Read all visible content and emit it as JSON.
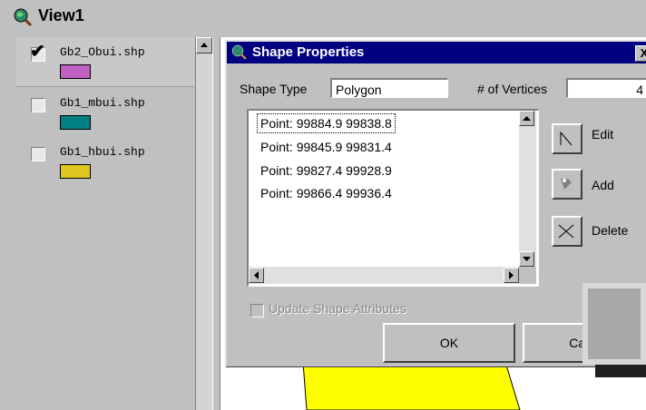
{
  "window": {
    "title": "View1",
    "icon": "globe-magnifier-icon"
  },
  "legend": {
    "items": [
      {
        "name": "Gb2_Obui.shp",
        "checked": true,
        "color": "#c060c0"
      },
      {
        "name": "Gb1_mbui.shp",
        "checked": false,
        "color": "#008080"
      },
      {
        "name": "Gb1_hbui.shp",
        "checked": false,
        "color": "#e0c820"
      }
    ]
  },
  "dialog": {
    "title": "Shape Properties",
    "close_label": "X",
    "shape_type_label": "Shape Type",
    "shape_type_value": "Polygon",
    "vertices_label": "# of Vertices",
    "vertices_value": "4",
    "points": [
      "Point: 99884.9 99838.8",
      "Point: 99845.9 99831.4",
      "Point: 99827.4 99928.9",
      "Point: 99866.4 99936.4"
    ],
    "edit_label": "Edit",
    "add_label": "Add",
    "delete_label": "Delete",
    "update_label": "Update Shape Attributes",
    "ok_label": "OK",
    "cancel_label": "Cancel"
  },
  "colors": {
    "title_bar": "#000080",
    "map_polygon": "#ffff00"
  }
}
